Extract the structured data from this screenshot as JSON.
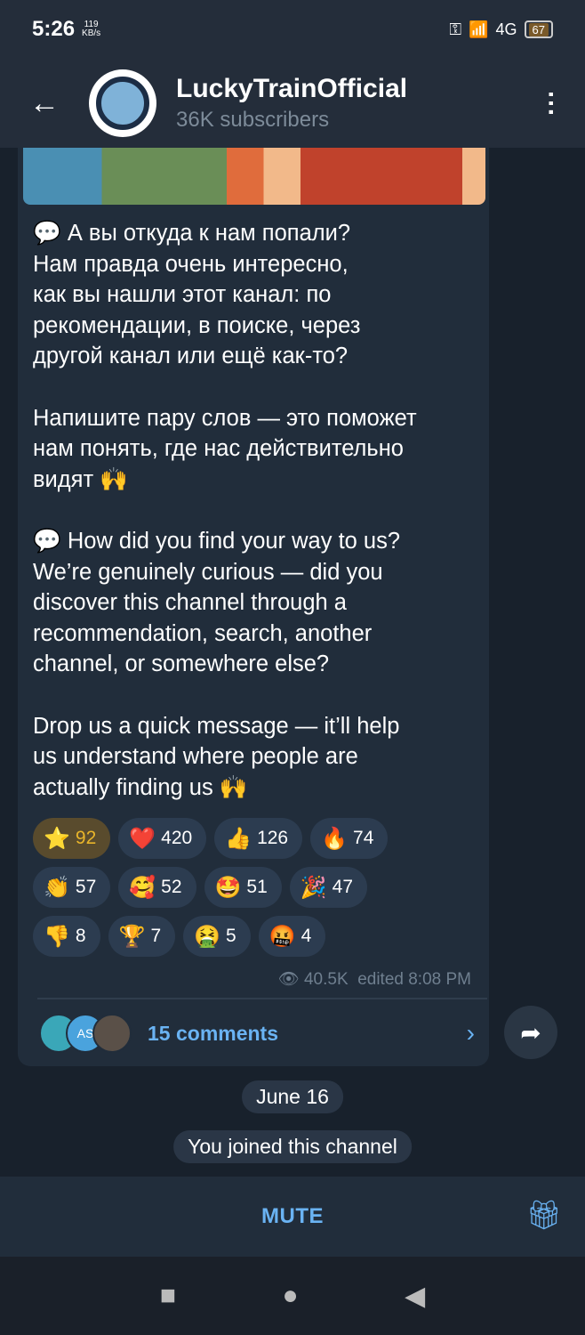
{
  "status": {
    "time": "5:26",
    "speed_value": "119",
    "speed_unit": "KB/s",
    "network": "4G",
    "battery": "67"
  },
  "header": {
    "title": "LuckyTrainOfficial",
    "subtitle": "36K subscribers"
  },
  "message": {
    "text": "💬 А вы откуда к нам попали?\nНам правда очень интересно,\nкак вы нашли этот канал: по\nрекомендации, в поиске, через\nдругой канал или ещё как-то?\n\nНапишите пару слов — это поможет\nнам понять, где нас действительно\nвидят 🙌\n\n💬 How did you find your way to us?\nWe’re genuinely curious — did you\ndiscover this channel through a\nrecommendation, search, another\nchannel, or somewhere else?\n\nDrop us a quick message — it’ll help\nus understand where people are\nactually finding us 🙌",
    "views": "40.5K",
    "edited": "edited 8:08 PM"
  },
  "reactions": [
    [
      {
        "emoji": "⭐",
        "count": "92"
      },
      {
        "emoji": "❤️",
        "count": "420"
      },
      {
        "emoji": "👍",
        "count": "126"
      },
      {
        "emoji": "🔥",
        "count": "74"
      }
    ],
    [
      {
        "emoji": "👏",
        "count": "57"
      },
      {
        "emoji": "🥰",
        "count": "52"
      },
      {
        "emoji": "🤩",
        "count": "51"
      },
      {
        "emoji": "🎉",
        "count": "47"
      }
    ],
    [
      {
        "emoji": "👎",
        "count": "8"
      },
      {
        "emoji": "🏆",
        "count": "7"
      },
      {
        "emoji": "🤮",
        "count": "5"
      },
      {
        "emoji": "🤬",
        "count": "4"
      }
    ]
  ],
  "comments": {
    "label": "15 comments",
    "avatar_initials": "AS"
  },
  "service": {
    "date": "June 16",
    "joined": "You joined this channel"
  },
  "bottom": {
    "mute": "MUTE"
  }
}
